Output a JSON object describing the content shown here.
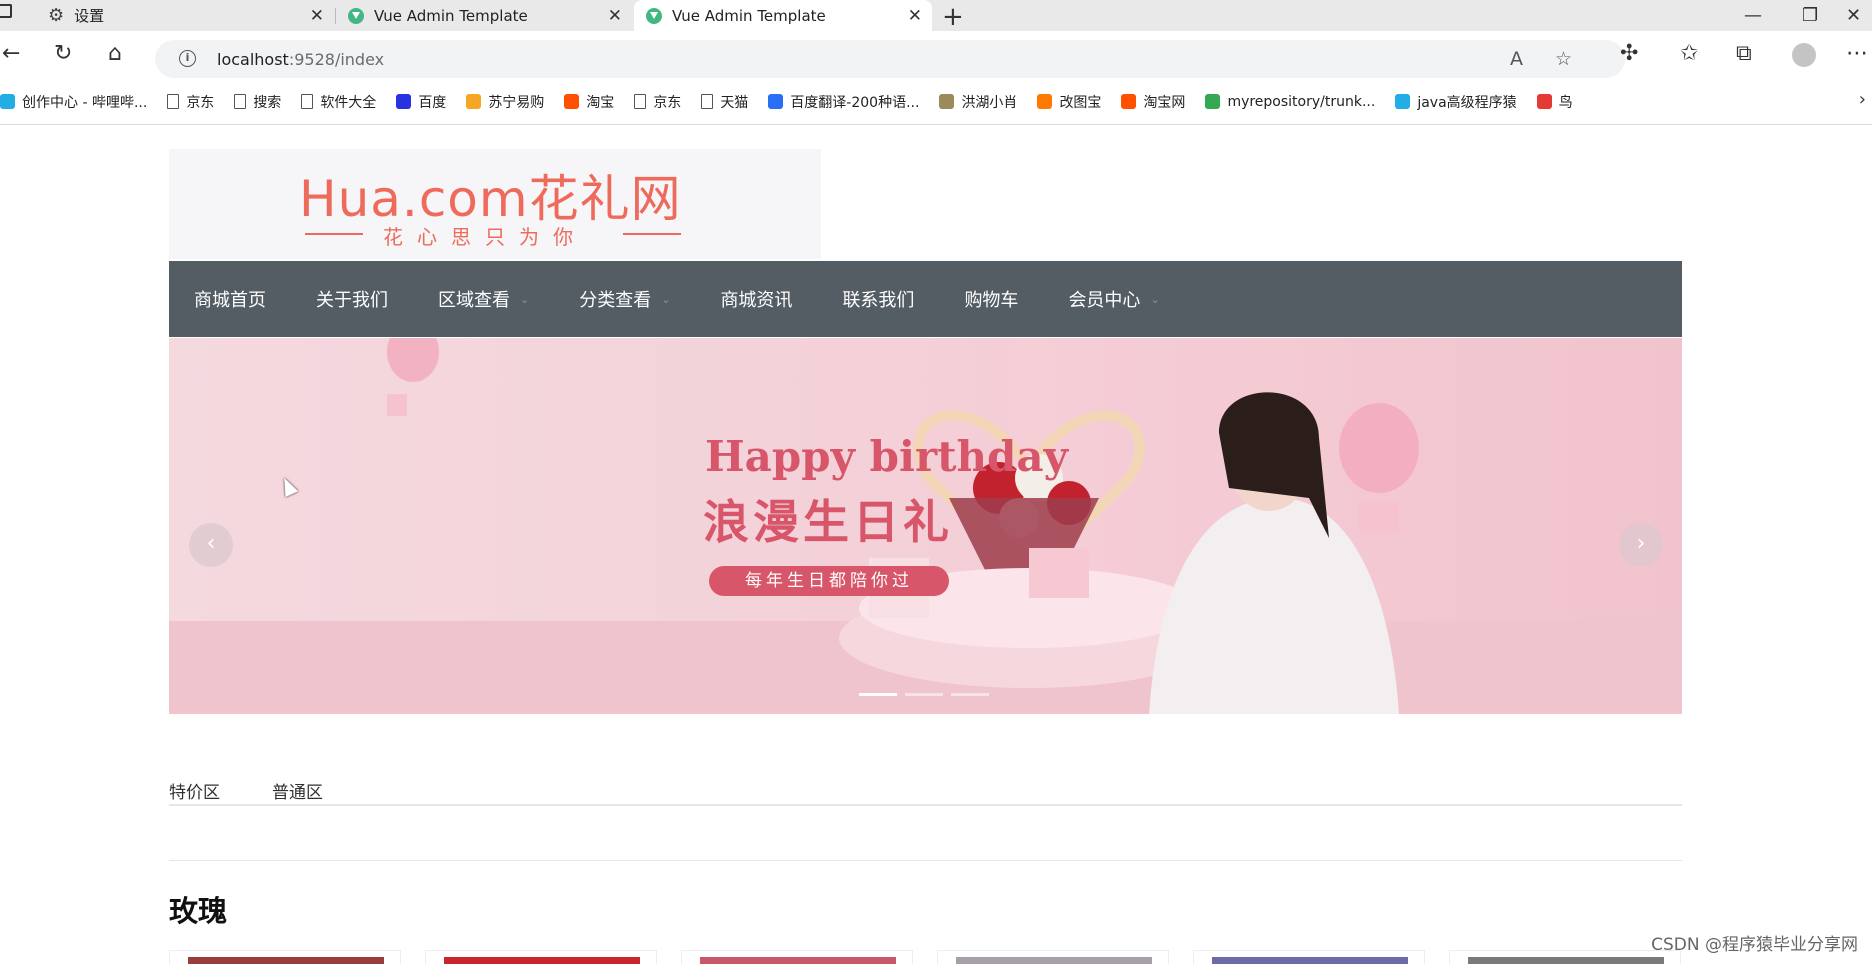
{
  "browser": {
    "tabs": [
      {
        "title": "设置",
        "icon": "gear-icon"
      },
      {
        "title": "Vue Admin Template",
        "icon": "vue-logo-icon"
      },
      {
        "title": "Vue Admin Template",
        "icon": "vue-logo-icon",
        "active": true
      }
    ],
    "url_host": "localhost",
    "url_path": ":9528/index",
    "bookmarks": [
      {
        "label": "创作中心 - 哔哩哔...",
        "color": "#23ade5"
      },
      {
        "label": "京东",
        "color": "doc"
      },
      {
        "label": "搜索",
        "color": "doc"
      },
      {
        "label": "软件大全",
        "color": "doc"
      },
      {
        "label": "百度",
        "color": "#2932e1"
      },
      {
        "label": "苏宁易购",
        "color": "#f5a623"
      },
      {
        "label": "淘宝",
        "color": "#ff5000"
      },
      {
        "label": "京东",
        "color": "doc"
      },
      {
        "label": "天猫",
        "color": "doc"
      },
      {
        "label": "百度翻译-200种语...",
        "color": "#2a6ef5"
      },
      {
        "label": "洪湖小肖",
        "color": "#9b8a5a"
      },
      {
        "label": "改图宝",
        "color": "#ff7a00"
      },
      {
        "label": "淘宝网",
        "color": "#ff5000"
      },
      {
        "label": "myrepository/trunk...",
        "color": "#34a853"
      },
      {
        "label": "java高级程序猿",
        "color": "#23ade5"
      },
      {
        "label": "鸟",
        "color": "#e53935"
      }
    ]
  },
  "site": {
    "logo_main": "Hua.com花礼网",
    "logo_sub": "花心思只为你",
    "nav": [
      {
        "label": "商城首页",
        "dropdown": false
      },
      {
        "label": "关于我们",
        "dropdown": false
      },
      {
        "label": "区域查看",
        "dropdown": true
      },
      {
        "label": "分类查看",
        "dropdown": true
      },
      {
        "label": "商城资讯",
        "dropdown": false
      },
      {
        "label": "联系我们",
        "dropdown": false
      },
      {
        "label": "购物车",
        "dropdown": false
      },
      {
        "label": "会员中心",
        "dropdown": true
      }
    ],
    "banner": {
      "title_en": "Happy birthday",
      "title_cn": "浪漫生日礼",
      "tagline": "每年生日都陪你过",
      "slide_count": 3,
      "active_slide": 1
    },
    "section_tabs": [
      "特价区",
      "普通区"
    ],
    "category_title": "玫瑰",
    "card_count": 6
  },
  "watermark": "CSDN @程序猿毕业分享网",
  "colors": {
    "nav_bg": "#545c64",
    "brand": "#ee6b5c",
    "banner_accent": "#d8566a"
  }
}
